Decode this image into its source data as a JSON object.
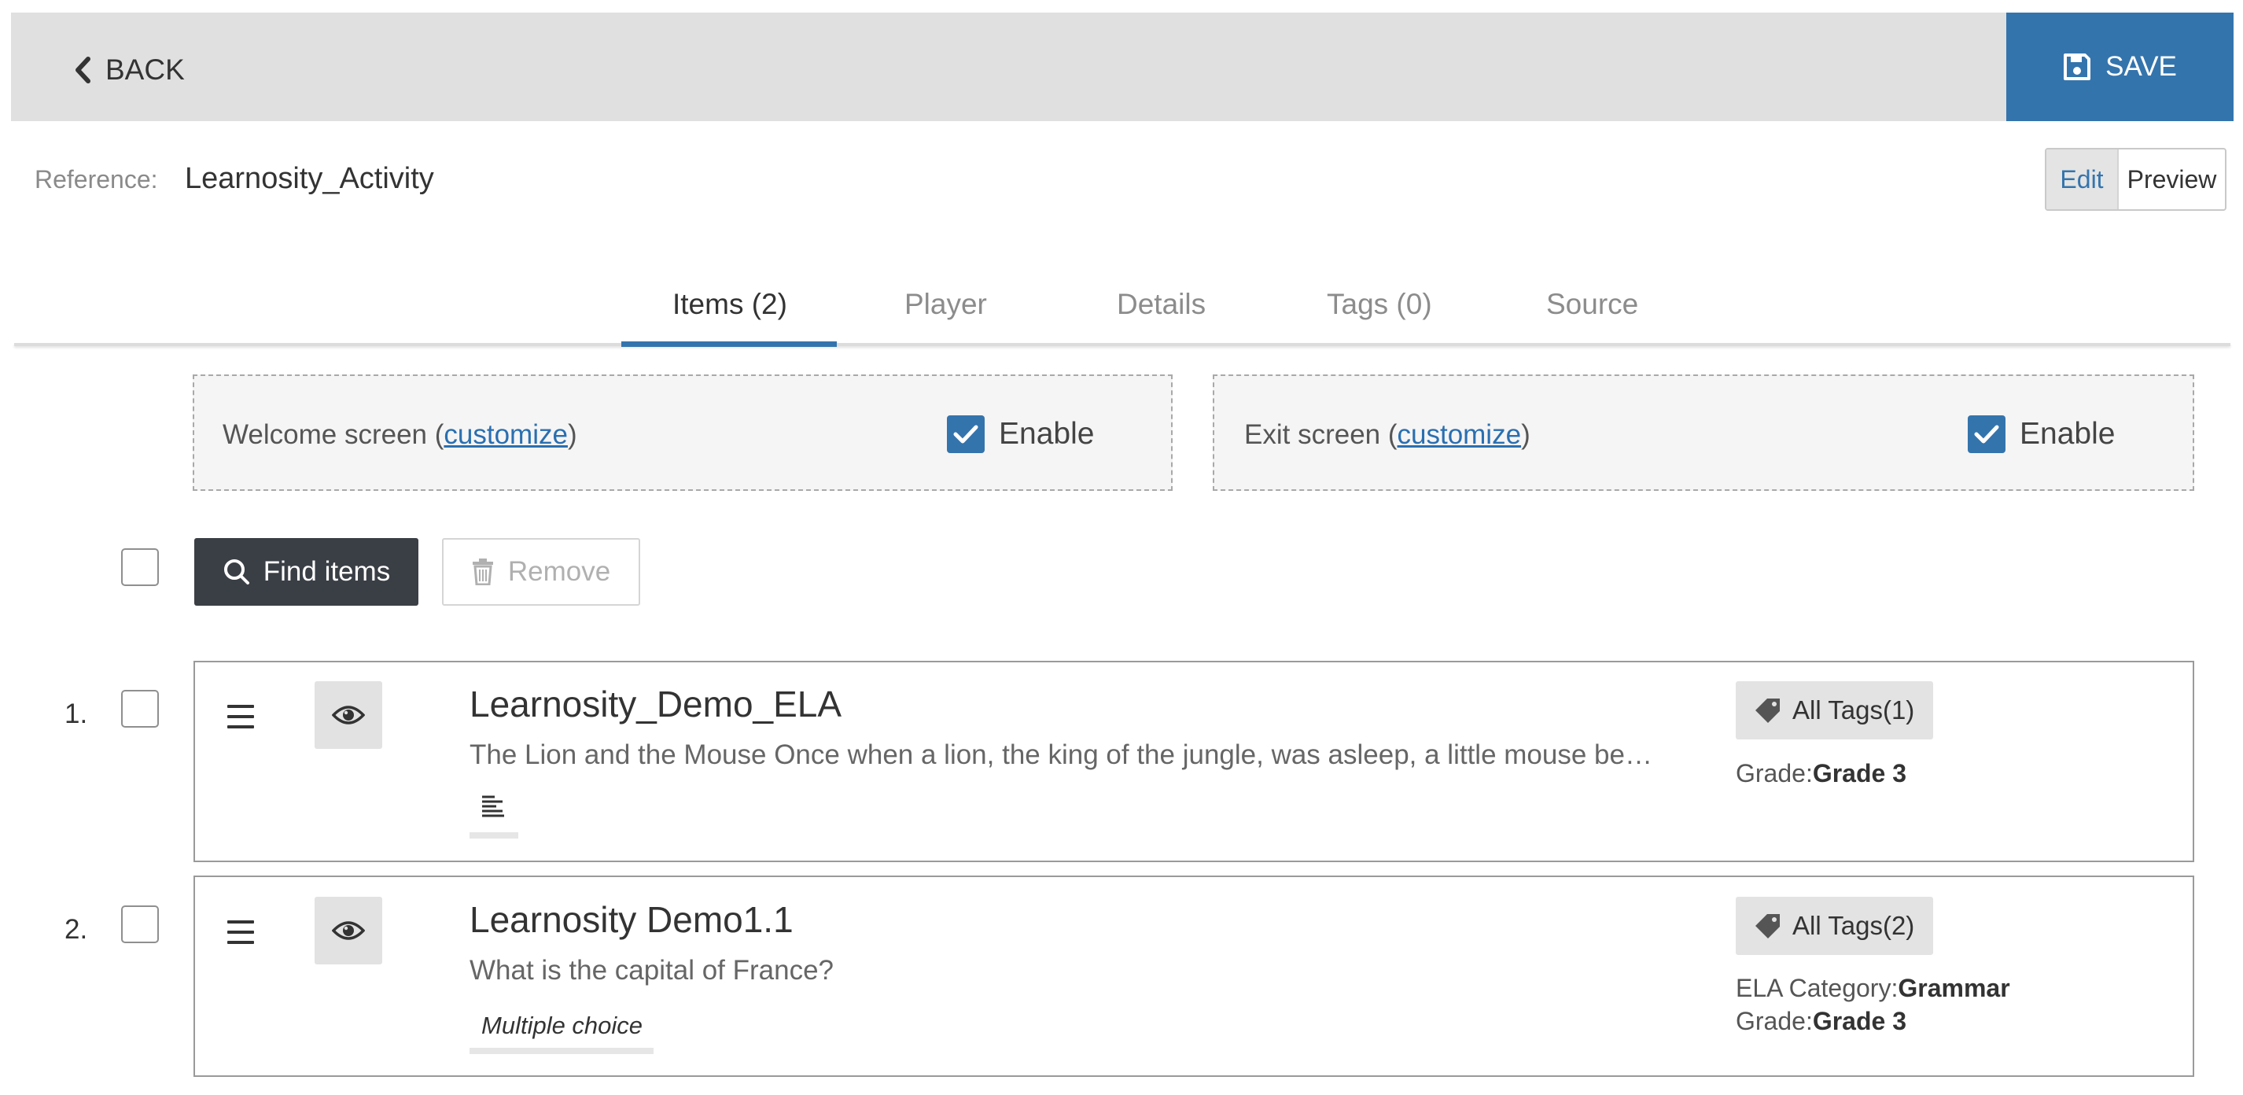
{
  "header": {
    "back_label": "BACK",
    "save_label": "SAVE"
  },
  "reference": {
    "label": "Reference:",
    "value": "Learnosity_Activity"
  },
  "mode": {
    "edit_label": "Edit",
    "preview_label": "Preview"
  },
  "tabs": [
    {
      "label": "Items (2)",
      "active": true
    },
    {
      "label": "Player",
      "active": false
    },
    {
      "label": "Details",
      "active": false
    },
    {
      "label": "Tags (0)",
      "active": false
    },
    {
      "label": "Source",
      "active": false
    }
  ],
  "welcome_screen": {
    "prefix": "Welcome screen (",
    "link": "customize",
    "suffix": ")",
    "enable_label": "Enable",
    "enabled": true
  },
  "exit_screen": {
    "prefix": "Exit screen (",
    "link": "customize",
    "suffix": ")",
    "enable_label": "Enable",
    "enabled": true
  },
  "actions": {
    "find_label": "Find items",
    "remove_label": "Remove"
  },
  "items": [
    {
      "number": "1.",
      "title": "Learnosity_Demo_ELA",
      "description": "The Lion and the Mouse Once when a lion, the king of the jungle, was asleep, a little mouse be…",
      "question_type": "",
      "question_type_icon": "text-lines-icon",
      "tags_label": "All Tags(1)",
      "meta": [
        {
          "key": "Grade:",
          "value": "Grade 3"
        }
      ]
    },
    {
      "number": "2.",
      "title": "Learnosity Demo1.1",
      "description": "What is the capital of France?",
      "question_type": "Multiple choice",
      "tags_label": "All Tags(2)",
      "meta": [
        {
          "key": "ELA Category:",
          "value": "Grammar"
        },
        {
          "key": "Grade:",
          "value": "Grade 3"
        }
      ]
    }
  ],
  "colors": {
    "accent": "#3474ad",
    "topbar": "#e0e0e0",
    "find_button": "#3a3f46"
  }
}
